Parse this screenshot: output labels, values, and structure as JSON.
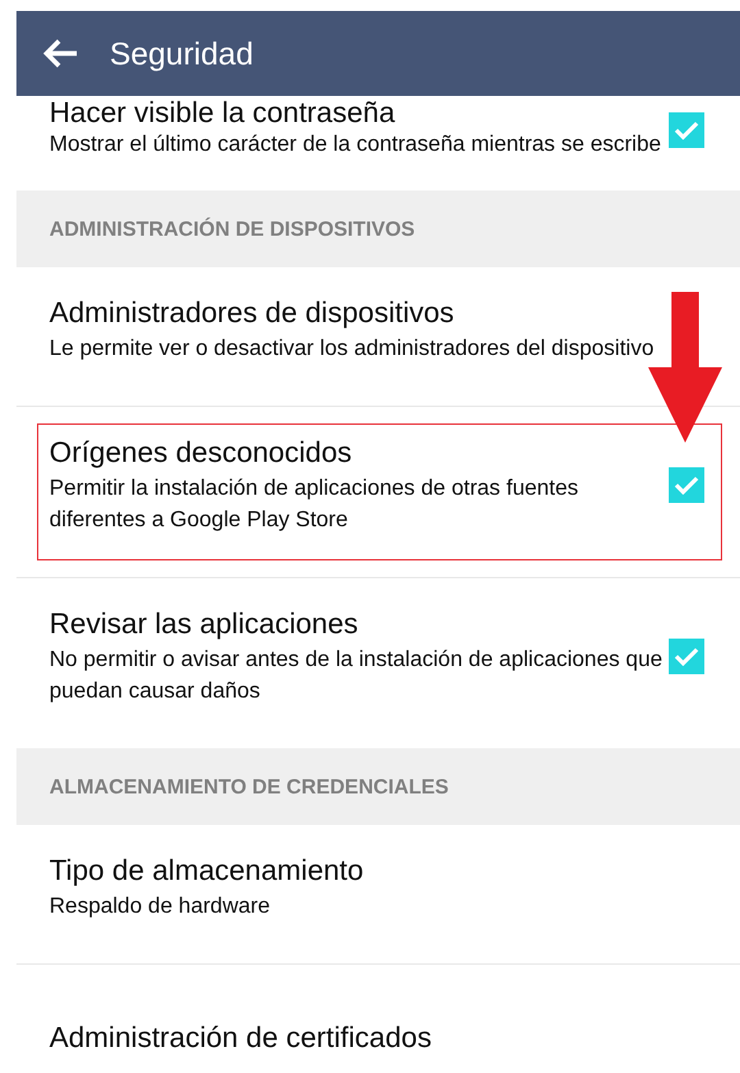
{
  "app_bar": {
    "title": "Seguridad"
  },
  "list": [
    {
      "kind": "setting",
      "title": "Hacer visible la contraseña",
      "summary": "Mostrar el último carácter de la contraseña mientras se escribe",
      "checked": true,
      "highlighted": false
    },
    {
      "kind": "header",
      "title": "ADMINISTRACIÓN DE DISPOSITIVOS"
    },
    {
      "kind": "setting",
      "title": "Administradores de dispositivos",
      "summary": "Le permite ver o desactivar los administradores del dispositivo",
      "highlighted": false
    },
    {
      "kind": "setting",
      "title": "Orígenes desconocidos",
      "summary": "Permitir la instalación de aplicaciones de otras fuentes diferentes a Google Play Store",
      "checked": true,
      "highlighted": true
    },
    {
      "kind": "setting",
      "title": "Revisar las aplicaciones",
      "summary": "No permitir o avisar antes de la instalación de aplicaciones que puedan causar daños",
      "checked": true,
      "highlighted": false
    },
    {
      "kind": "header",
      "title": "ALMACENAMIENTO DE CREDENCIALES"
    },
    {
      "kind": "setting",
      "title": "Tipo de almacenamiento",
      "summary": "Respaldo de hardware",
      "highlighted": false
    },
    {
      "kind": "setting",
      "title": "Administración de certificados",
      "highlighted": false
    }
  ]
}
